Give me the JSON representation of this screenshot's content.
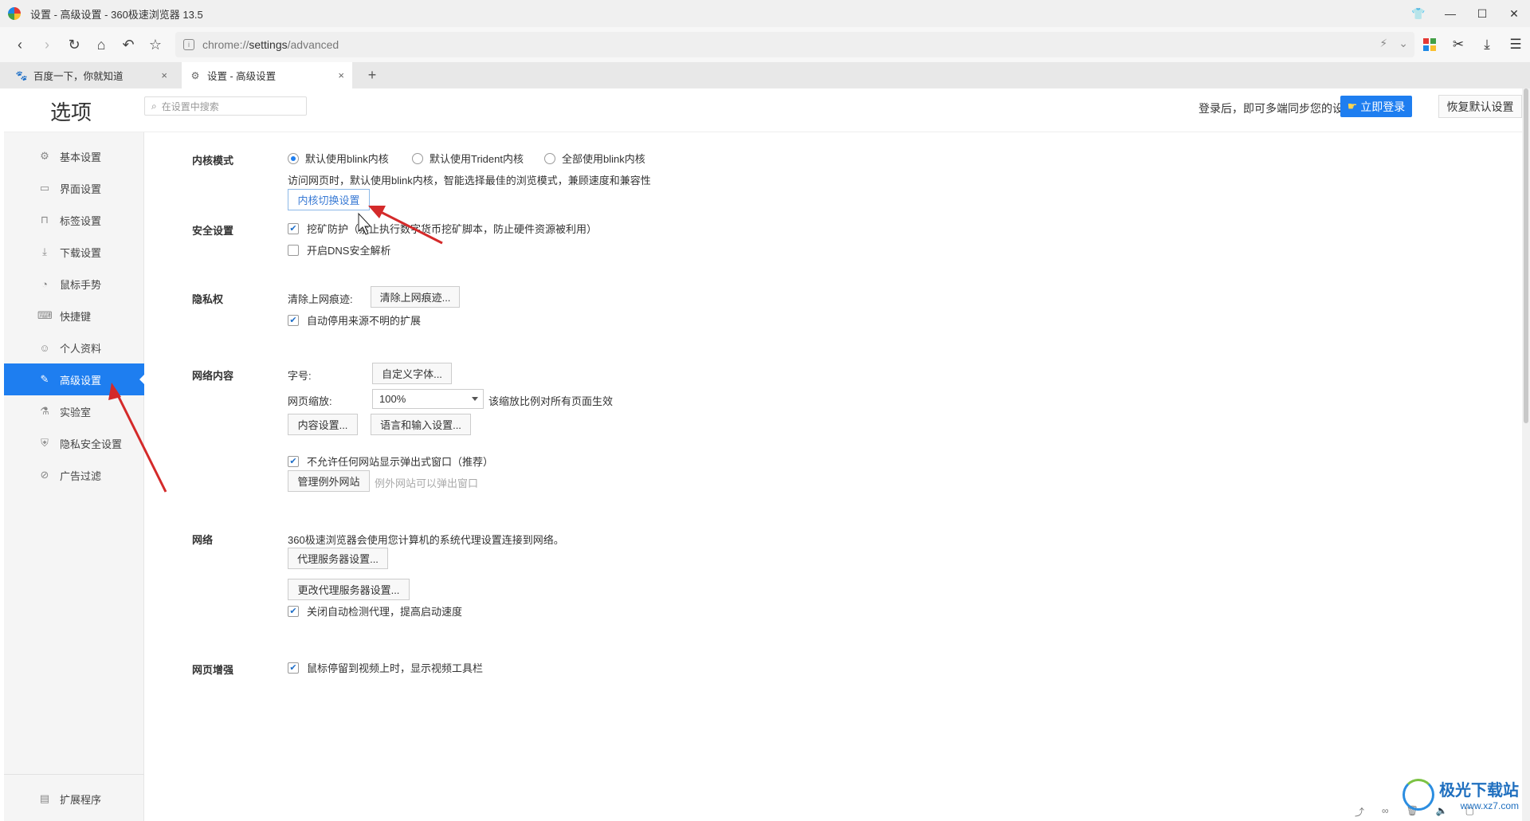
{
  "window": {
    "title": "设置 - 高级设置 - 360极速浏览器 13.5"
  },
  "address": {
    "scheme": "chrome://",
    "host": "settings",
    "path": "/advanced"
  },
  "tabs": [
    {
      "label": "百度一下，你就知道"
    },
    {
      "label": "设置 - 高级设置"
    }
  ],
  "header": {
    "title": "选项",
    "search_placeholder": "在设置中搜索",
    "sync_text": "登录后，即可多端同步您的设置",
    "login_label": "立即登录",
    "reset_label": "恢复默认设置"
  },
  "sidebar": {
    "items": [
      {
        "label": "基本设置",
        "icon": "gear-icon"
      },
      {
        "label": "界面设置",
        "icon": "window-icon"
      },
      {
        "label": "标签设置",
        "icon": "tab-icon"
      },
      {
        "label": "下载设置",
        "icon": "download-icon"
      },
      {
        "label": "鼠标手势",
        "icon": "mouse-icon"
      },
      {
        "label": "快捷键",
        "icon": "keyboard-icon"
      },
      {
        "label": "个人资料",
        "icon": "user-icon"
      },
      {
        "label": "高级设置",
        "icon": "wrench-icon",
        "active": true
      },
      {
        "label": "实验室",
        "icon": "flask-icon"
      },
      {
        "label": "隐私安全设置",
        "icon": "shield-icon"
      },
      {
        "label": "广告过滤",
        "icon": "block-icon"
      }
    ],
    "footer_label": "扩展程序"
  },
  "kernel": {
    "title": "内核模式",
    "options": [
      "默认使用blink内核",
      "默认使用Trident内核",
      "全部使用blink内核"
    ],
    "selected_index": 0,
    "description": "访问网页时，默认使用blink内核，智能选择最佳的浏览模式，兼顾速度和兼容性",
    "switch_button": "内核切换设置"
  },
  "security": {
    "title": "安全设置",
    "mining_label": "挖矿防护（禁止执行数字货币挖矿脚本，防止硬件资源被利用）",
    "mining_checked": true,
    "dns_label": "开启DNS安全解析",
    "dns_checked": false
  },
  "privacy": {
    "title": "隐私权",
    "clear_label": "清除上网痕迹:",
    "clear_button": "清除上网痕迹...",
    "auto_disable_label": "自动停用来源不明的扩展",
    "auto_disable_checked": true
  },
  "web_content": {
    "title": "网络内容",
    "font_label": "字号:",
    "font_button": "自定义字体...",
    "zoom_label": "网页缩放:",
    "zoom_value": "100%",
    "zoom_note": "该缩放比例对所有页面生效",
    "content_button": "内容设置...",
    "language_button": "语言和输入设置...",
    "popup_label": "不允许任何网站显示弹出式窗口（推荐）",
    "popup_checked": true,
    "manage_button": "管理例外网站",
    "manage_note": "例外网站可以弹出窗口"
  },
  "network": {
    "title": "网络",
    "description": "360极速浏览器会使用您计算机的系统代理设置连接到网络。",
    "proxy_button": "代理服务器设置...",
    "change_proxy_button": "更改代理服务器设置...",
    "auto_detect_label": "关闭自动检测代理，提高启动速度",
    "auto_detect_checked": true
  },
  "enhance": {
    "title": "网页增强",
    "video_toolbar_label": "鼠标停留到视频上时，显示视频工具栏",
    "video_toolbar_checked": true
  },
  "watermark": {
    "name": "极光下载站",
    "url": "www.xz7.com"
  },
  "colors": {
    "accent": "#1e7ef0",
    "annotation": "#d42a2a"
  }
}
